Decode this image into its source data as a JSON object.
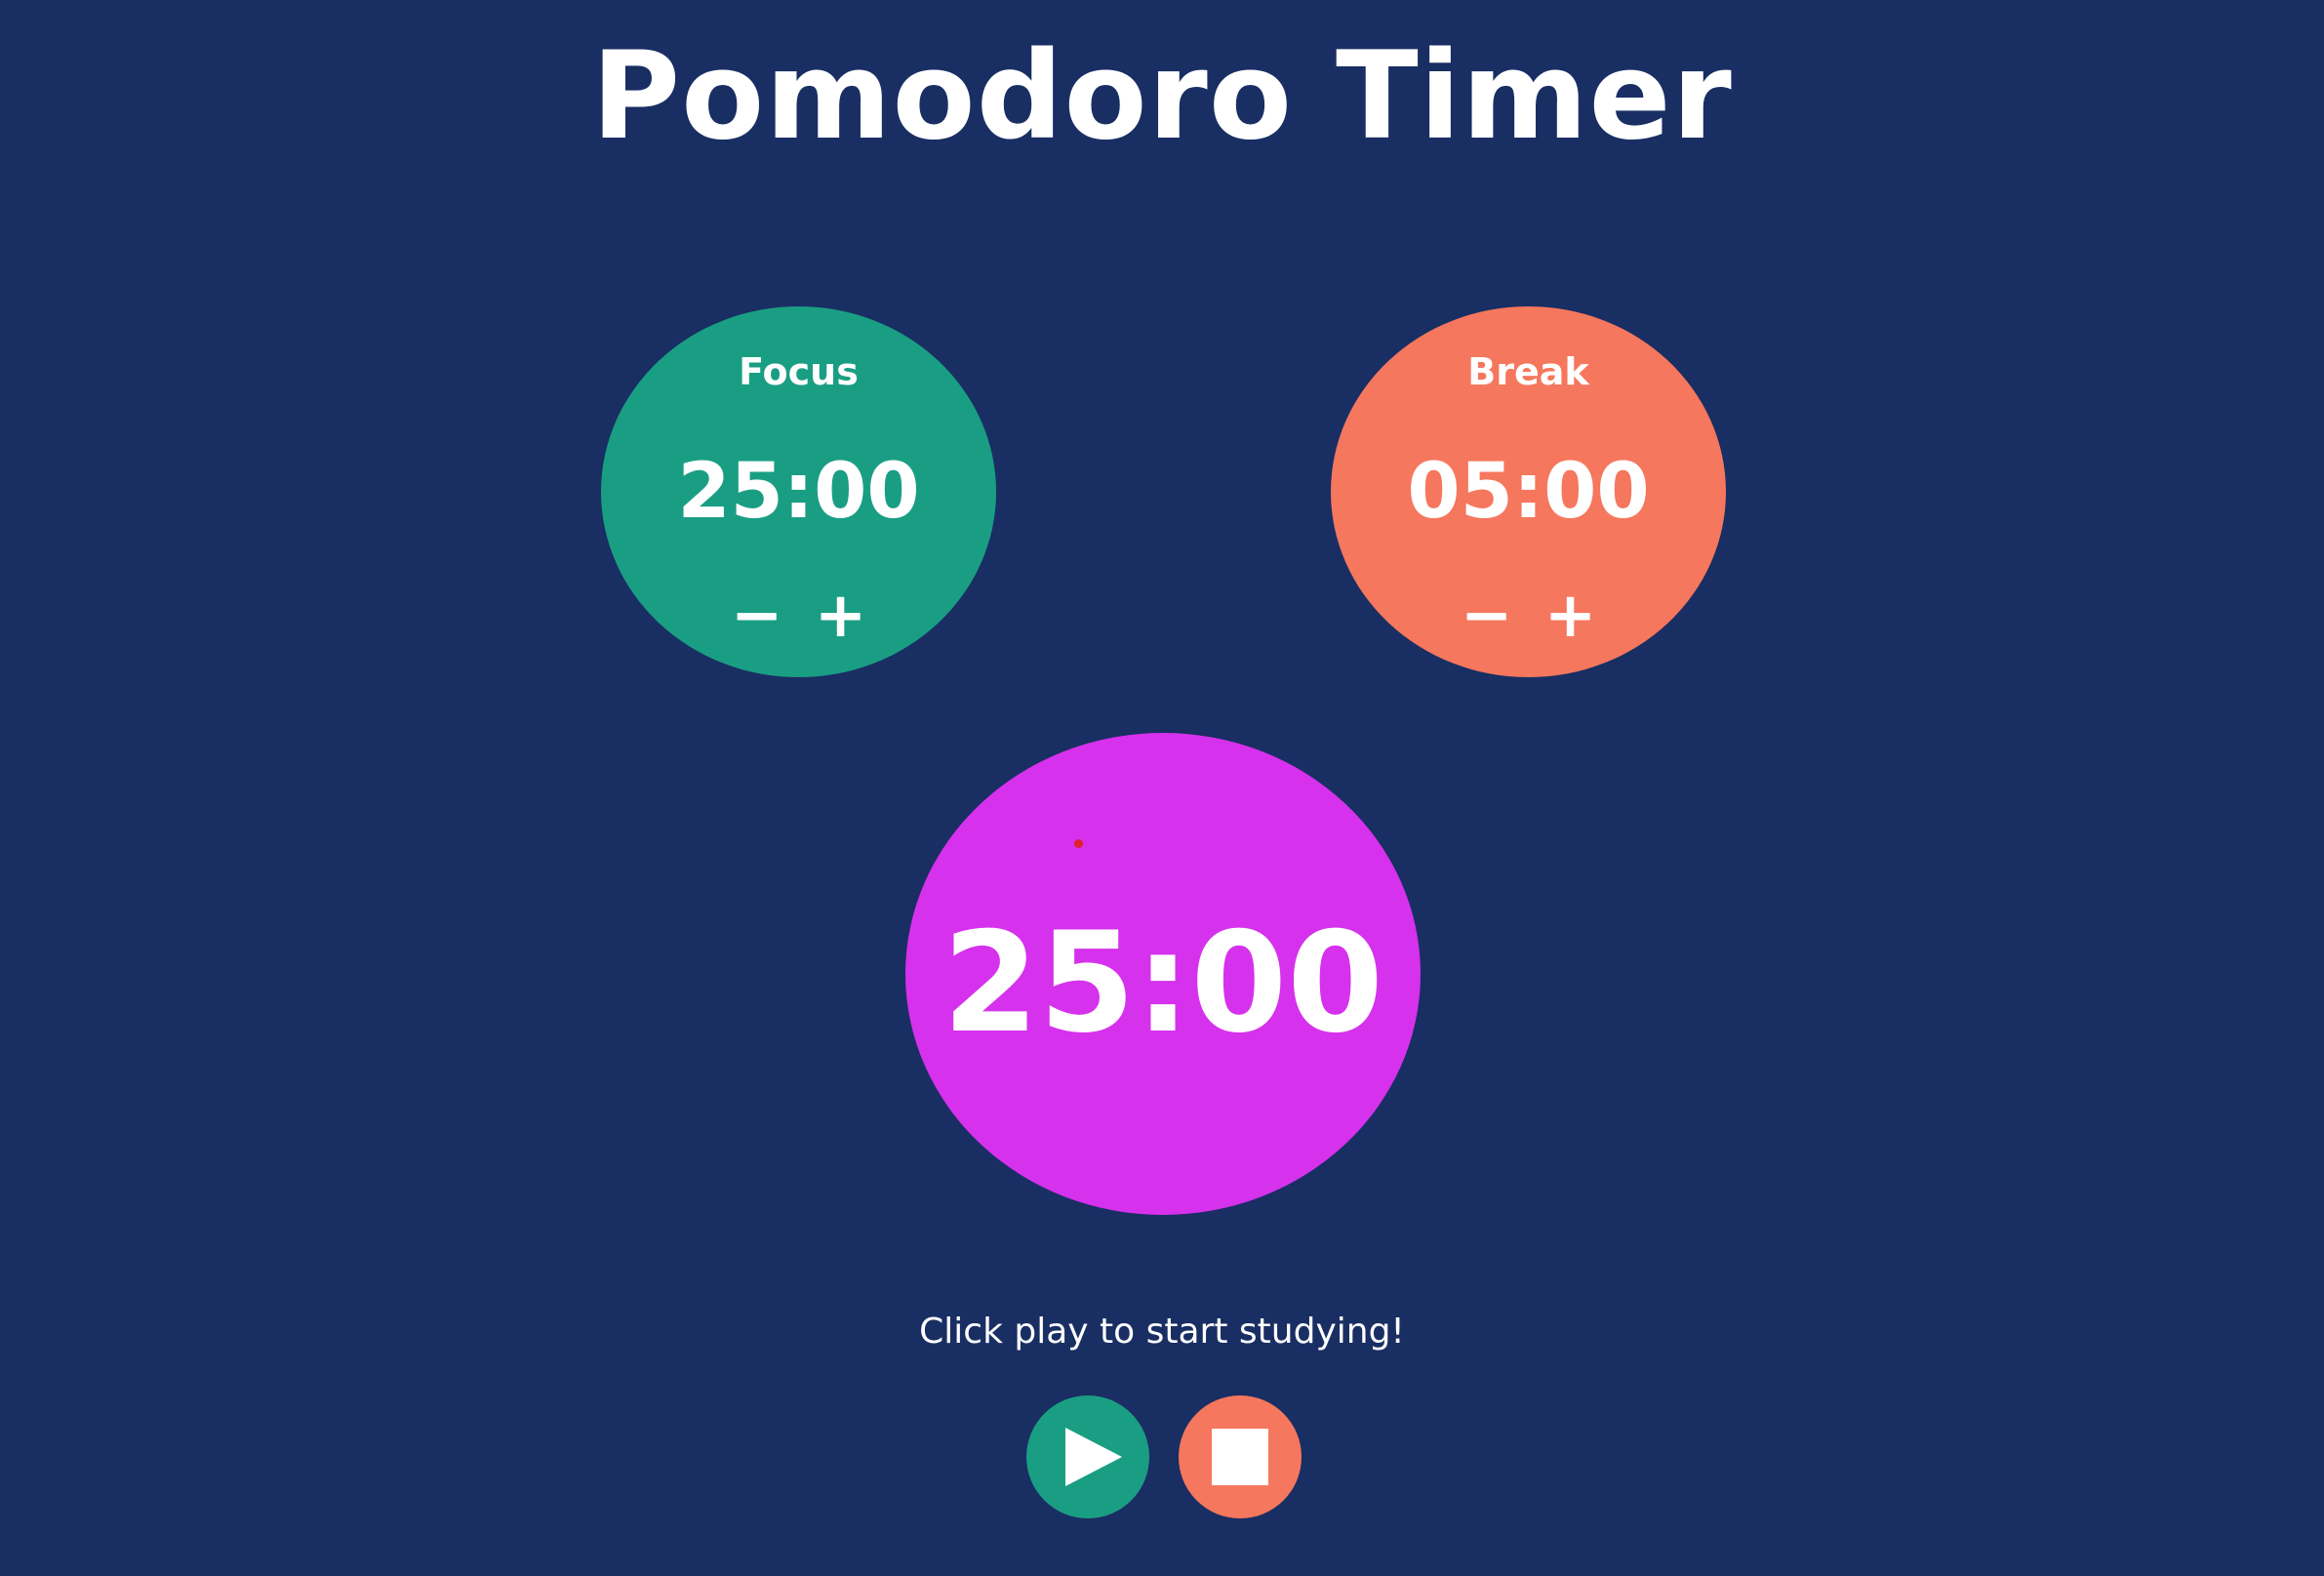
{
  "app": {
    "title": "Pomodoro Timer"
  },
  "colors": {
    "background": "#192e63",
    "focus": "#1a9e83",
    "break": "#f5775d",
    "timer": "#d631ec",
    "dot": "#e0202a",
    "text": "#ffffff"
  },
  "focus": {
    "label": "Focus",
    "time": "25:00",
    "decrement_label": "−",
    "increment_label": "+"
  },
  "break": {
    "label": "Break",
    "time": "05:00",
    "decrement_label": "−",
    "increment_label": "+"
  },
  "timer": {
    "time": "25:00"
  },
  "status": {
    "message": "Click play to start studying!"
  },
  "controls": {
    "play_icon": "play-icon",
    "stop_icon": "stop-icon"
  }
}
